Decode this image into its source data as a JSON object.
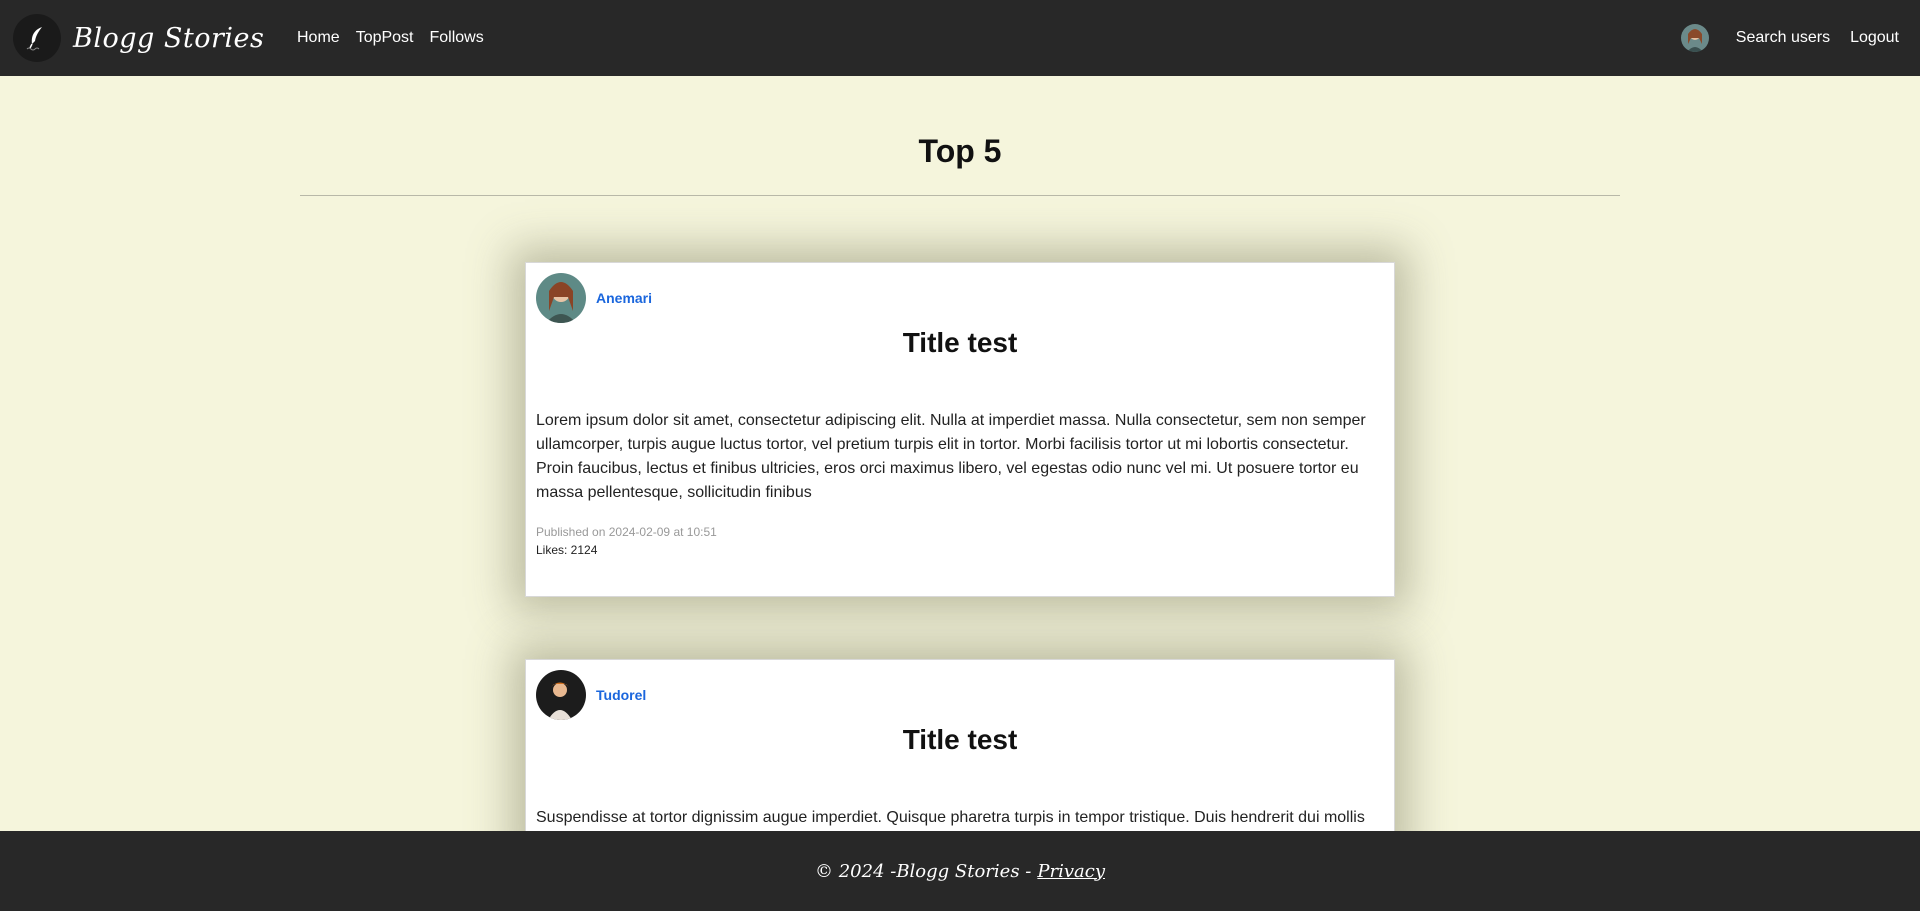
{
  "header": {
    "brand": "Blogg Stories",
    "nav": [
      "Home",
      "TopPost",
      "Follows"
    ],
    "search_users": "Search users",
    "logout": "Logout"
  },
  "page": {
    "title": "Top 5"
  },
  "posts": [
    {
      "author": "Anemari",
      "title": "Title test",
      "body": "Lorem ipsum dolor sit amet, consectetur adipiscing elit. Nulla at imperdiet massa. Nulla consectetur, sem non semper ullamcorper, turpis augue luctus tortor, vel pretium turpis elit in tortor. Morbi facilisis tortor ut mi lobortis consectetur. Proin faucibus, lectus et finibus ultricies, eros orci maximus libero, vel egestas odio nunc vel mi. Ut posuere tortor eu massa pellentesque, sollicitudin finibus",
      "published": "Published on 2024-02-09 at 10:51",
      "likes": "Likes: 2124"
    },
    {
      "author": "Tudorel",
      "title": "Title test",
      "body": "Suspendisse at tortor dignissim augue imperdiet. Quisque pharetra turpis in tempor tristique. Duis hendrerit dui mollis"
    }
  ],
  "footer": {
    "text": "© 2024 -Blogg Stories - ",
    "privacy": "Privacy"
  },
  "colors": {
    "header_bg": "#282828",
    "page_bg": "#f5f5dc",
    "author_link": "#1a66dd"
  }
}
